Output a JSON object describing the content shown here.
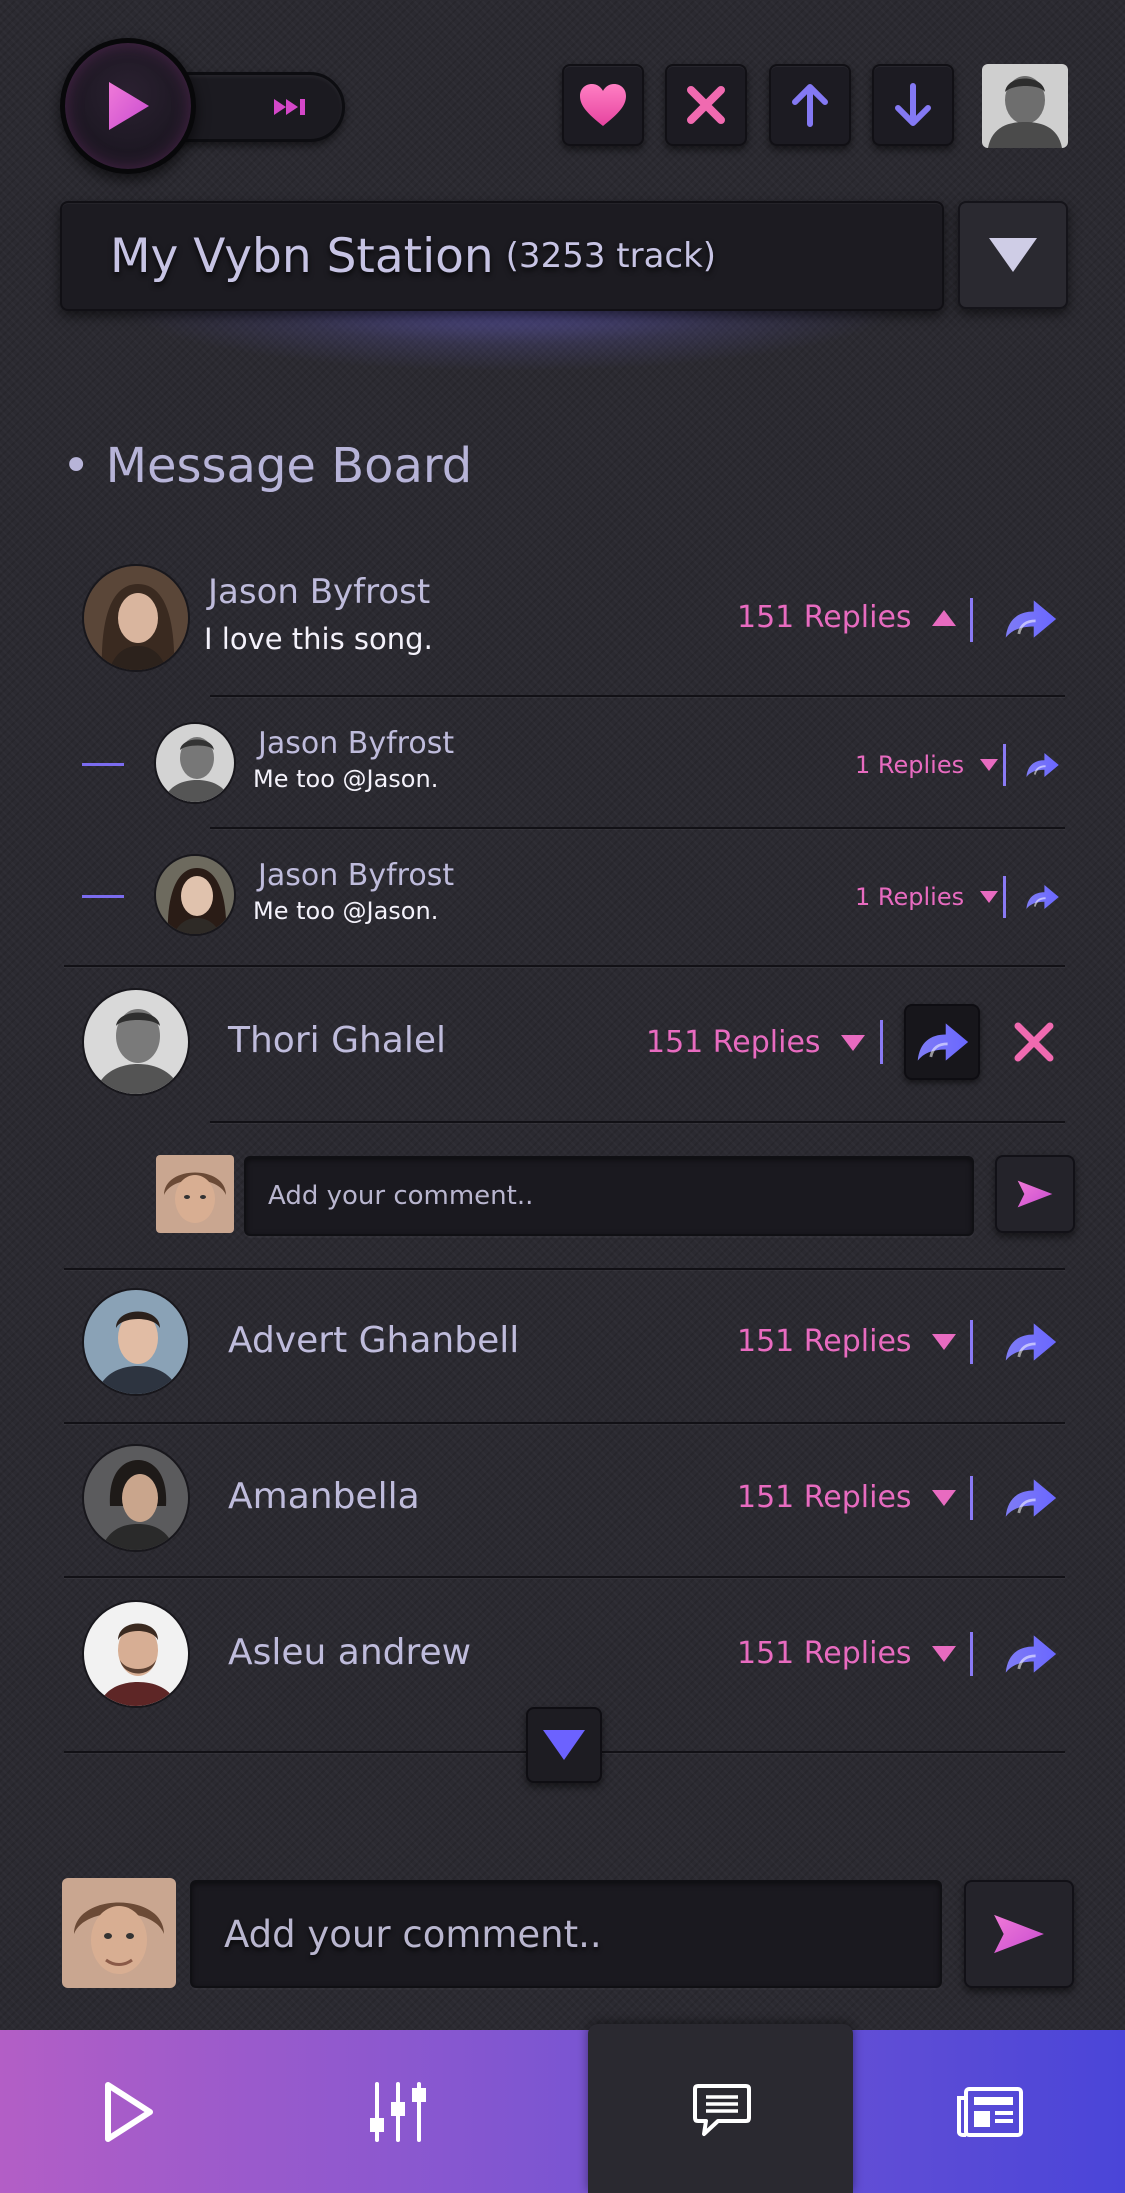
{
  "player": {
    "station_name": "My Vybn Station",
    "station_count": "(3253 track)"
  },
  "board": {
    "title": "• Message Board",
    "comments": [
      {
        "name": "Jason Byfrost",
        "message": "I love this song.",
        "replies": "151 Replies"
      },
      {
        "name": "Jason Byfrost",
        "message": "Me too @Jason.",
        "replies": "1 Replies"
      },
      {
        "name": "Jason Byfrost",
        "message": "Me too @Jason.",
        "replies": "1 Replies"
      },
      {
        "name": "Thori Ghalel",
        "replies": "151 Replies"
      },
      {
        "name": "Advert Ghanbell",
        "replies": "151 Replies"
      },
      {
        "name": "Amanbella",
        "replies": "151 Replies"
      },
      {
        "name": "Asleu andrew",
        "replies": "151 Replies"
      }
    ],
    "inline_comment_placeholder": "Add your comment..",
    "main_comment_placeholder": "Add your comment.."
  },
  "colors": {
    "accent_pink": "#e86bc0",
    "accent_violet": "#7b6cf0",
    "nav_gradient_start": "#b35ec6",
    "nav_gradient_end": "#4a45d8",
    "background": "#2b2a31"
  },
  "icons": {
    "play": "play-icon",
    "fast_forward": "fast-forward-icon",
    "like": "heart-icon",
    "dislike": "close-icon",
    "up": "arrow-up-icon",
    "down": "arrow-down-icon",
    "share": "share-icon",
    "send": "send-icon",
    "nav": [
      "play-icon",
      "equalizer-icon",
      "chat-icon",
      "news-icon"
    ]
  }
}
